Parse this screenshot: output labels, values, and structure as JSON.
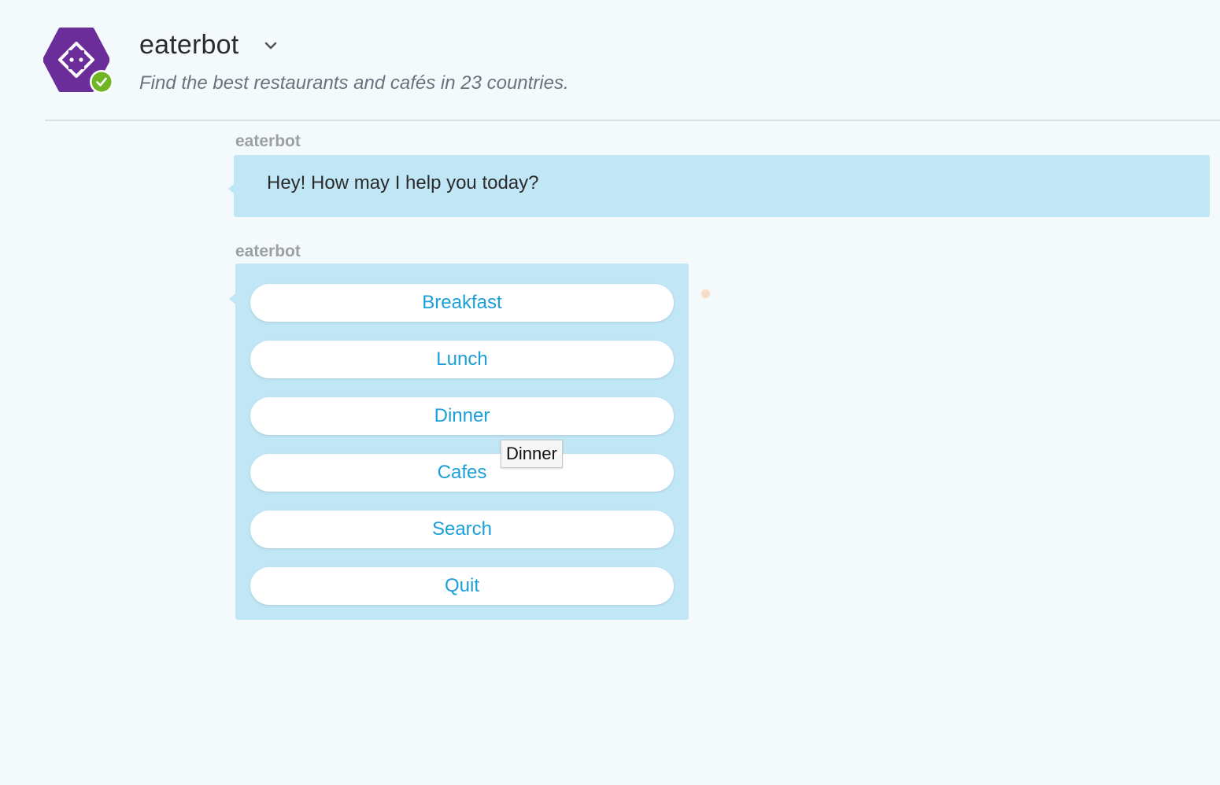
{
  "header": {
    "bot_name": "eaterbot",
    "description": "Find the best restaurants and cafés in 23 countries.",
    "avatar_icon": "bot-code-hexagon-icon",
    "badge_icon": "verified-check-icon",
    "chevron_icon": "chevron-down-icon"
  },
  "messages": [
    {
      "sender": "eaterbot",
      "text": "Hey! How may I help you today?"
    },
    {
      "sender": "eaterbot",
      "choices": [
        "Breakfast",
        "Lunch",
        "Dinner",
        "Cafes",
        "Search",
        "Quit"
      ]
    }
  ],
  "tooltip": {
    "text": "Dinner"
  },
  "colors": {
    "background": "#f4f9fc",
    "bubble": "#c1e6f6",
    "accent": "#1a9fd9",
    "avatar": "#6b2d9a",
    "verified": "#6fb524",
    "typing_dot": "#f8dcc3"
  }
}
